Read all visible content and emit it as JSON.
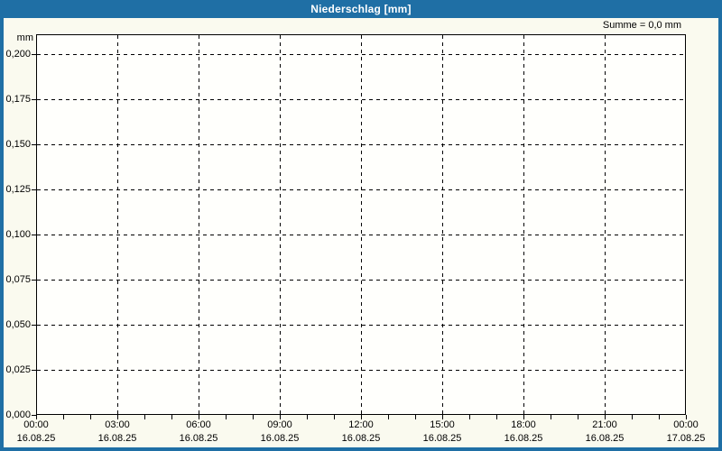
{
  "window": {
    "title": "Niederschlag [mm]"
  },
  "header": {
    "sum_label": "Summe = 0,0 mm"
  },
  "y_axis": {
    "unit": "mm",
    "tick_labels": [
      "0,200",
      "0,175",
      "0,150",
      "0,125",
      "0,100",
      "0,075",
      "0,050",
      "0,025",
      "0,000"
    ]
  },
  "x_axis": {
    "major_ticks": [
      {
        "time": "00:00",
        "date": "16.08.25"
      },
      {
        "time": "03:00",
        "date": "16.08.25"
      },
      {
        "time": "06:00",
        "date": "16.08.25"
      },
      {
        "time": "09:00",
        "date": "16.08.25"
      },
      {
        "time": "12:00",
        "date": "16.08.25"
      },
      {
        "time": "15:00",
        "date": "16.08.25"
      },
      {
        "time": "18:00",
        "date": "16.08.25"
      },
      {
        "time": "21:00",
        "date": "16.08.25"
      },
      {
        "time": "00:00",
        "date": "17.08.25"
      }
    ],
    "minor_ticks_per_hour": 1,
    "minor_tick_count": 25
  },
  "colors": {
    "accent_blue": "#1f6fa5",
    "window_background": "#fafaef",
    "plot_background": "#fffffc",
    "grid": "#000000",
    "title_text": "#ffffff",
    "label_text": "#000000"
  },
  "chart_data": {
    "type": "bar",
    "title": "Niederschlag [mm]",
    "xlabel": "",
    "ylabel": "mm",
    "x": [],
    "values": [],
    "series_note": "no precipitation data plotted; chart is empty, total sum 0,0 mm",
    "annotations": [
      "Summe = 0,0 mm"
    ],
    "ylim": [
      0.0,
      0.211
    ],
    "y_tick_step": 0.025,
    "xlim": [
      "16.08.25 00:00",
      "17.08.25 00:00"
    ],
    "x_tick_step_hours": 3,
    "x_minor_tick_step_hours": 1,
    "grid": "dashed",
    "legend_position": "none"
  }
}
